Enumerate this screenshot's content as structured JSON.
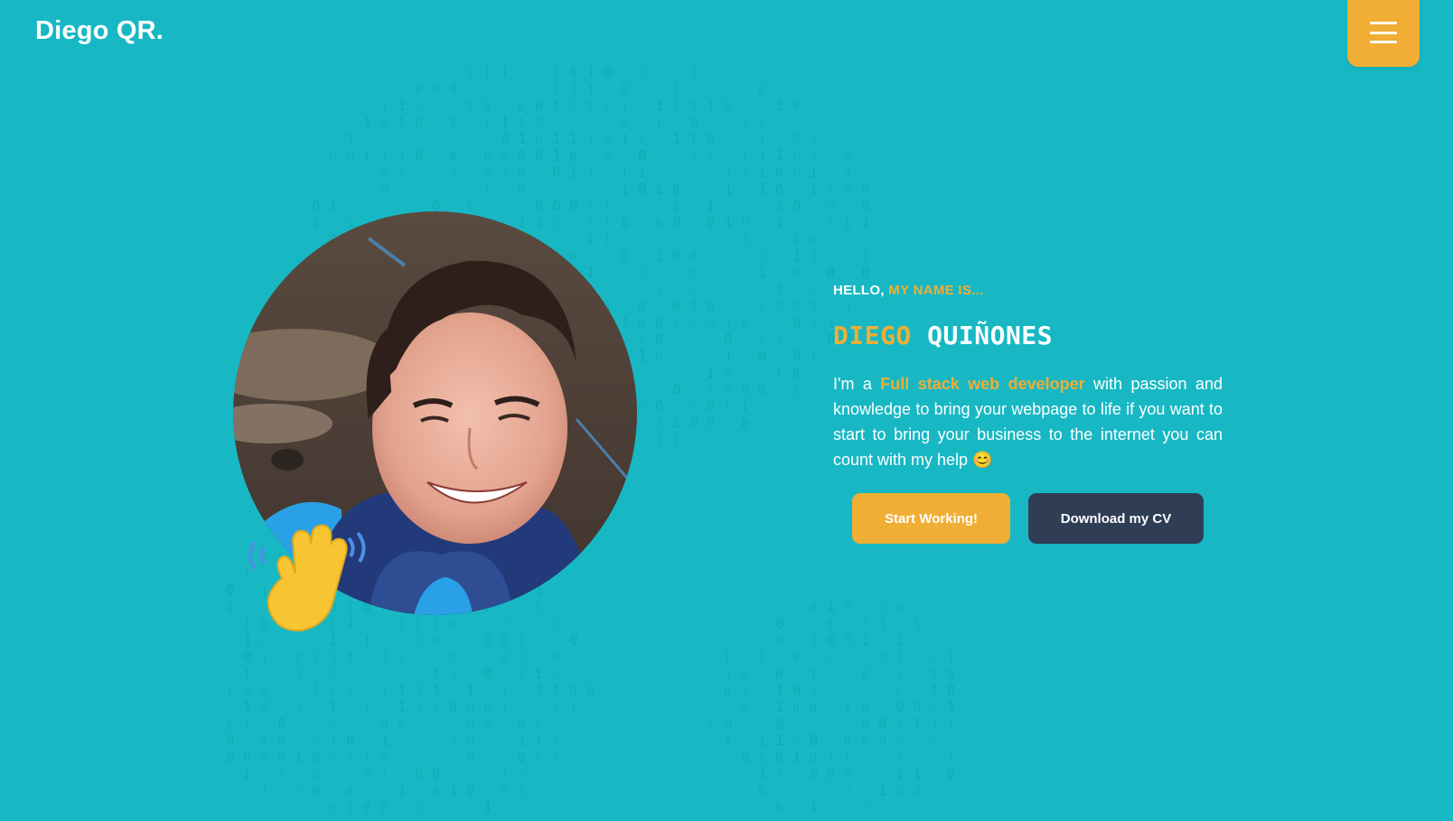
{
  "colors": {
    "background": "#17b8c4",
    "accent": "#f0ae34",
    "dark": "#2f3d55",
    "text": "#ffffff",
    "binary_digits": "#0fa7b3"
  },
  "header": {
    "logo": "Diego QR.",
    "menu_icon": "hamburger-menu-icon"
  },
  "hero": {
    "photo_alt": "Portrait photo of Diego",
    "wave_icon": "waving-hand-icon",
    "greeting_prefix": "HELLO,",
    "greeting_highlight": "MY NAME IS...",
    "first_name": "DIEGO",
    "last_name": "QUIÑONES",
    "bio": {
      "before": "I'm a",
      "highlight": "Full stack web developer",
      "after": "with passion and knowledge to bring your webpage to life if you want to start to bring your business to the internet you can count with my help",
      "emoji": "😊"
    },
    "buttons": {
      "primary": "Start Working!",
      "secondary": "Download my CV"
    }
  }
}
